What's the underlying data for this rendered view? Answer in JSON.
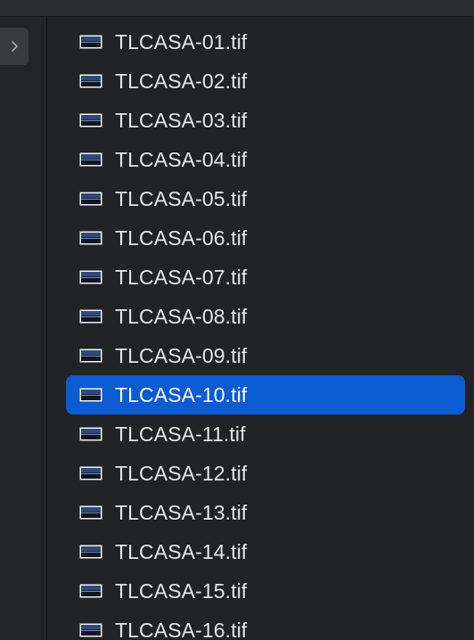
{
  "sidebar": {
    "expand_icon": "chevron-right-icon"
  },
  "file_list": {
    "file_icon": "image-file-icon",
    "selected_index": 9,
    "colors": {
      "selection": "#0b5bd3",
      "text": "#e6e6e8",
      "background": "#222326"
    },
    "items": [
      {
        "name": "TLCASA-01.tif"
      },
      {
        "name": "TLCASA-02.tif"
      },
      {
        "name": "TLCASA-03.tif"
      },
      {
        "name": "TLCASA-04.tif"
      },
      {
        "name": "TLCASA-05.tif"
      },
      {
        "name": "TLCASA-06.tif"
      },
      {
        "name": "TLCASA-07.tif"
      },
      {
        "name": "TLCASA-08.tif"
      },
      {
        "name": "TLCASA-09.tif"
      },
      {
        "name": "TLCASA-10.tif"
      },
      {
        "name": "TLCASA-11.tif"
      },
      {
        "name": "TLCASA-12.tif"
      },
      {
        "name": "TLCASA-13.tif"
      },
      {
        "name": "TLCASA-14.tif"
      },
      {
        "name": "TLCASA-15.tif"
      },
      {
        "name": "TLCASA-16.tif"
      }
    ]
  }
}
